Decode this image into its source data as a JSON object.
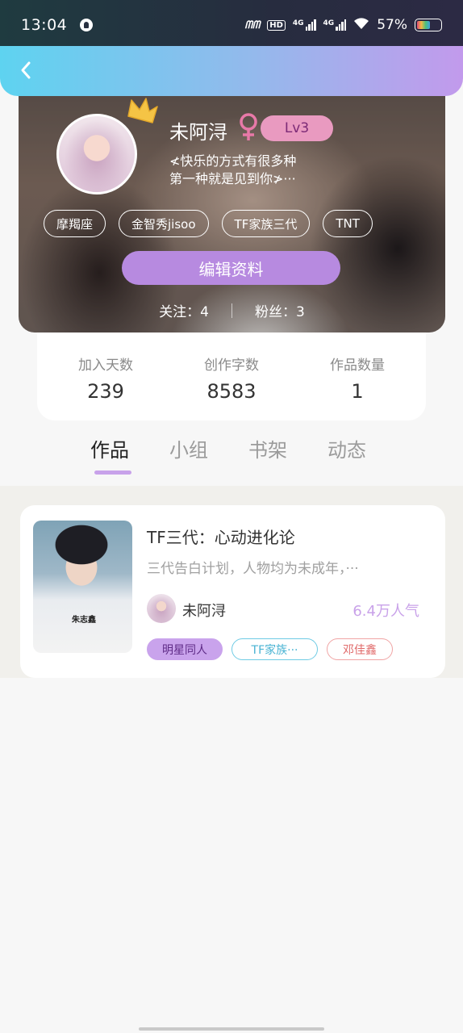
{
  "status_bar": {
    "time": "13:04",
    "battery_percent": "57%",
    "network_left": "4G",
    "network_right": "4G",
    "hd_label": "HD"
  },
  "header": {
    "back_icon": "chevron-left-icon"
  },
  "profile": {
    "username": "未阿浔",
    "gender_icon": "female-icon",
    "level": "Lv3",
    "bio_line1": "≮快乐的方式有很多种",
    "bio_line2": "第一种就是见到你≯···",
    "tags": [
      "摩羯座",
      "金智秀jisoo",
      "TF家族三代",
      "TNT"
    ],
    "edit_button": "编辑资料",
    "following": "关注：4",
    "followers": "粉丝：3"
  },
  "stats": [
    {
      "label": "加入天数",
      "value": "239"
    },
    {
      "label": "创作字数",
      "value": "8583"
    },
    {
      "label": "作品数量",
      "value": "1"
    }
  ],
  "tabs": [
    {
      "label": "作品",
      "active": true
    },
    {
      "label": "小组",
      "active": false
    },
    {
      "label": "书架",
      "active": false
    },
    {
      "label": "动态",
      "active": false
    }
  ],
  "works": [
    {
      "title": "TF三代：心动进化论",
      "description": "三代告白计划，人物均为未成年，···",
      "cover_text": "朱志鑫",
      "author": "未阿浔",
      "popularity": "6.4万人气",
      "tags": [
        "明星同人",
        "TF家族···",
        "邓佳鑫"
      ]
    }
  ],
  "colors": {
    "header_gradient_start": "#5ed3f0",
    "header_gradient_end": "#c29aec",
    "accent_purple": "#b78ae0",
    "level_badge": "#e99ac0"
  }
}
